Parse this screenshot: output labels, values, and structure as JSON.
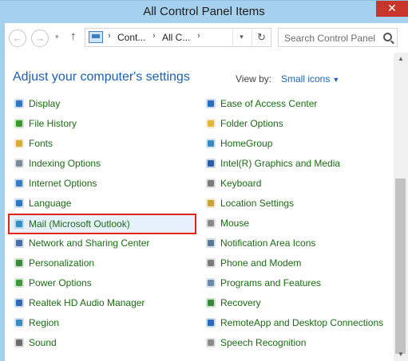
{
  "window": {
    "title": "All Control Panel Items",
    "close_glyph": "✕"
  },
  "nav": {
    "back_glyph": "←",
    "forward_glyph": "→",
    "recent_glyph": "▾",
    "up_glyph": "↑",
    "breadcrumb": [
      "Cont...",
      "All C..."
    ],
    "sep_glyph": "›",
    "dropdown_glyph": "▾",
    "refresh_glyph": "↻",
    "search_placeholder": "Search Control Panel"
  },
  "header": {
    "title": "Adjust your computer's settings",
    "view_by_label": "View by:",
    "view_by_value": "Small icons",
    "view_caret": "▼"
  },
  "items_left": [
    {
      "label": "Display",
      "icon": "display-icon",
      "color": "#2f78c4"
    },
    {
      "label": "File History",
      "icon": "file-history-icon",
      "color": "#3a9a2a"
    },
    {
      "label": "Fonts",
      "icon": "fonts-icon",
      "color": "#d9a93a"
    },
    {
      "label": "Indexing Options",
      "icon": "indexing-options-icon",
      "color": "#7a8a99"
    },
    {
      "label": "Internet Options",
      "icon": "internet-options-icon",
      "color": "#3b7ac4"
    },
    {
      "label": "Language",
      "icon": "language-icon",
      "color": "#2f78c4"
    },
    {
      "label": "Mail (Microsoft Outlook)",
      "icon": "mail-icon",
      "color": "#2f8fc4",
      "highlight": true
    },
    {
      "label": "Network and Sharing Center",
      "icon": "network-icon",
      "color": "#4b6fa8"
    },
    {
      "label": "Personalization",
      "icon": "personalization-icon",
      "color": "#3b8a3a"
    },
    {
      "label": "Power Options",
      "icon": "power-options-icon",
      "color": "#3f9a3a"
    },
    {
      "label": "Realtek HD Audio Manager",
      "icon": "realtek-audio-icon",
      "color": "#2d6ab8"
    },
    {
      "label": "Region",
      "icon": "region-icon",
      "color": "#3a8ac4"
    },
    {
      "label": "Sound",
      "icon": "sound-icon",
      "color": "#6a6a6a"
    }
  ],
  "items_right": [
    {
      "label": "Ease of Access Center",
      "icon": "ease-of-access-icon",
      "color": "#2a6ec4"
    },
    {
      "label": "Folder Options",
      "icon": "folder-options-icon",
      "color": "#e2b43c"
    },
    {
      "label": "HomeGroup",
      "icon": "homegroup-icon",
      "color": "#3a8ac4"
    },
    {
      "label": "Intel(R) Graphics and Media",
      "icon": "intel-graphics-icon",
      "color": "#2a5ea8"
    },
    {
      "label": "Keyboard",
      "icon": "keyboard-icon",
      "color": "#7a7a7a"
    },
    {
      "label": "Location Settings",
      "icon": "location-settings-icon",
      "color": "#c9a23a"
    },
    {
      "label": "Mouse",
      "icon": "mouse-icon",
      "color": "#8a8a8a"
    },
    {
      "label": "Notification Area Icons",
      "icon": "notification-area-icon",
      "color": "#5a7a9a"
    },
    {
      "label": "Phone and Modem",
      "icon": "phone-modem-icon",
      "color": "#7a7a7a"
    },
    {
      "label": "Programs and Features",
      "icon": "programs-features-icon",
      "color": "#6a8aa8"
    },
    {
      "label": "Recovery",
      "icon": "recovery-icon",
      "color": "#3a8a3a"
    },
    {
      "label": "RemoteApp and Desktop Connections",
      "icon": "remoteapp-icon",
      "color": "#2a6ab8"
    },
    {
      "label": "Speech Recognition",
      "icon": "speech-recognition-icon",
      "color": "#8a8a8a"
    }
  ],
  "scroll": {
    "up_glyph": "▲",
    "down_glyph": "▼",
    "position": 0.55
  }
}
